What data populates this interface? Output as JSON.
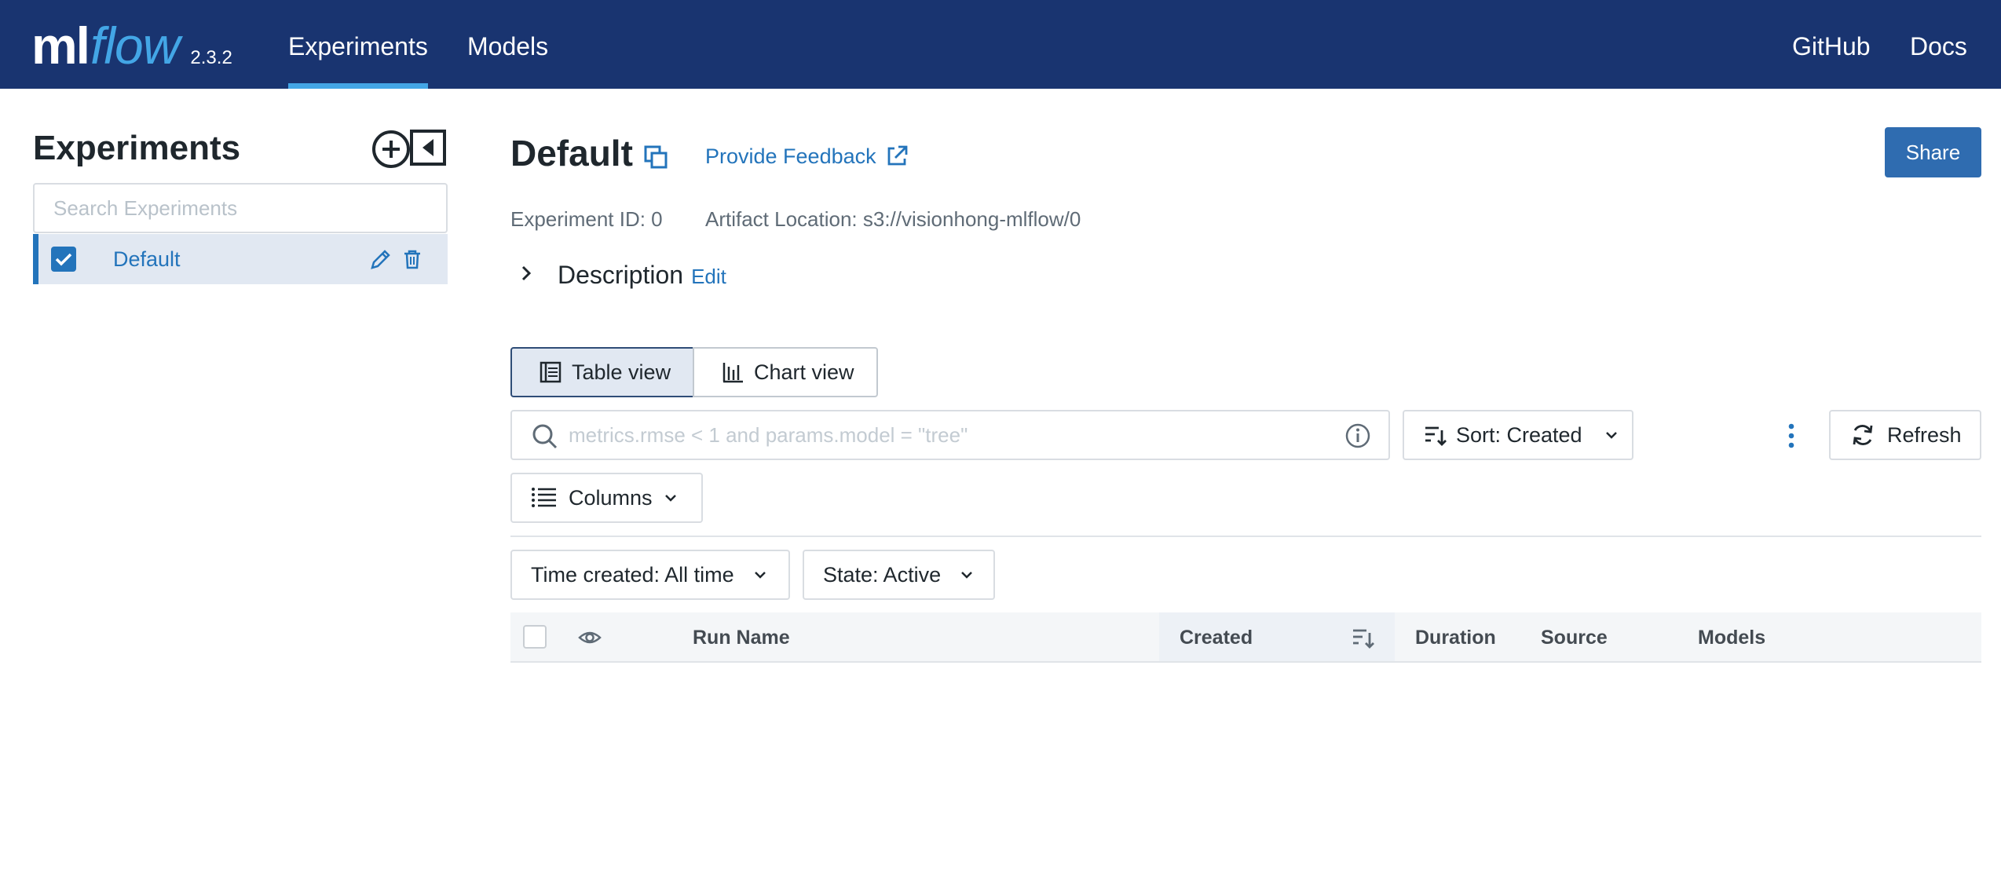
{
  "nav": {
    "logo_ml": "ml",
    "logo_flow": "flow",
    "version": "2.3.2",
    "links": [
      {
        "label": "Experiments",
        "active": true
      },
      {
        "label": "Models",
        "active": false
      }
    ],
    "right_links": [
      {
        "label": "GitHub"
      },
      {
        "label": "Docs"
      }
    ]
  },
  "sidebar": {
    "title": "Experiments",
    "search_placeholder": "Search Experiments",
    "experiments": [
      {
        "name": "Default",
        "checked": true
      }
    ]
  },
  "main": {
    "title": "Default",
    "feedback_label": "Provide Feedback",
    "share_label": "Share",
    "experiment_id": "Experiment ID: 0",
    "artifact_location": "Artifact Location: s3://visionhong-mlflow/0",
    "description_label": "Description",
    "description_edit": "Edit",
    "views": [
      {
        "label": "Table view",
        "active": true
      },
      {
        "label": "Chart view",
        "active": false
      }
    ],
    "filter_placeholder": "metrics.rmse < 1 and params.model = \"tree\"",
    "sort_label": "Sort: Created",
    "refresh_label": "Refresh",
    "columns_label": "Columns",
    "time_filter": "Time created: All time",
    "state_filter": "State: Active",
    "table_columns": [
      "Run Name",
      "Created",
      "Duration",
      "Source",
      "Models"
    ]
  },
  "colors": {
    "nav_bg": "#193470",
    "accent": "#43a6e6",
    "link": "#2374bb",
    "primary_button": "#2f6cb0"
  }
}
